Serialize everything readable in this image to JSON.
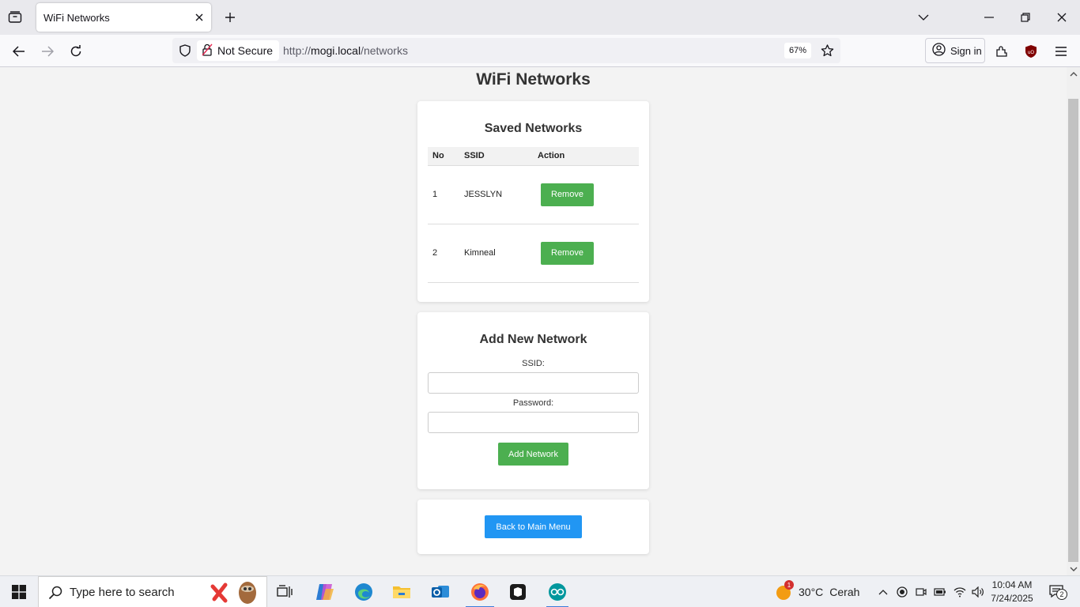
{
  "browser": {
    "tab_title": "WiFi Networks",
    "security_label": "Not Secure",
    "url_prefix": "http://",
    "url_host": "mogi.local",
    "url_path": "/networks",
    "zoom": "67%",
    "signin_label": "Sign in"
  },
  "page": {
    "title": "WiFi Networks",
    "saved": {
      "heading": "Saved Networks",
      "columns": [
        "No",
        "SSID",
        "Action"
      ],
      "rows": [
        {
          "no": "1",
          "ssid": "JESSLYN",
          "action": "Remove"
        },
        {
          "no": "2",
          "ssid": "Kimneal",
          "action": "Remove"
        }
      ]
    },
    "add": {
      "heading": "Add New Network",
      "ssid_label": "SSID:",
      "password_label": "Password:",
      "ssid_value": "",
      "password_value": "",
      "submit_label": "Add Network"
    },
    "back_label": "Back to Main Menu"
  },
  "taskbar": {
    "search_placeholder": "Type here to search",
    "weather_temp": "30°C",
    "weather_desc": "Cerah",
    "weather_badge": "1",
    "time": "10:04 AM",
    "date": "7/24/2025",
    "notification_count": "2"
  },
  "colors": {
    "green_button": "#4caf50",
    "blue_button": "#2196f3",
    "page_bg": "#f3f3f3"
  }
}
